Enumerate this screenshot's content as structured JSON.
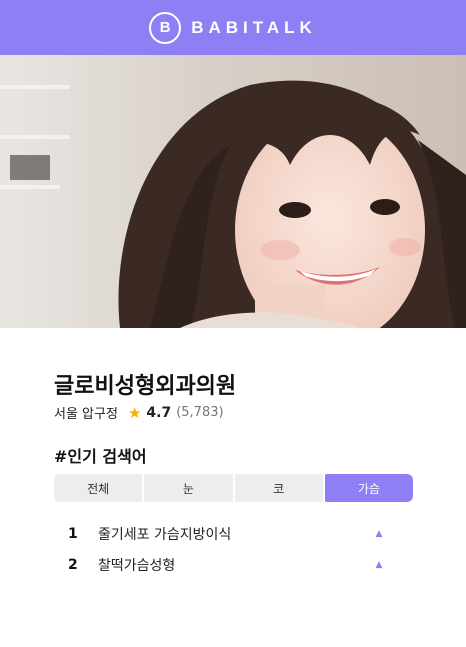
{
  "header": {
    "logo_mark": "B",
    "brand": "BABITALK"
  },
  "hero": {
    "image": "portrait-photo"
  },
  "clinic": {
    "name": "글로비성형외과의원",
    "location": "서울 압구정",
    "rating": "4.7",
    "review_count": "(5,783)"
  },
  "popular": {
    "title": "#인기 검색어",
    "tabs": [
      "전체",
      "눈",
      "코",
      "가슴"
    ],
    "active_tab": "가슴",
    "keywords": [
      {
        "rank": "1",
        "term": "줄기세포 가슴지방이식",
        "trend": "up"
      },
      {
        "rank": "2",
        "term": "찰떡가슴성형",
        "trend": "up"
      }
    ]
  },
  "colors": {
    "accent": "#8f7ff5",
    "star": "#f5b100",
    "tab_bg": "#ededed"
  }
}
